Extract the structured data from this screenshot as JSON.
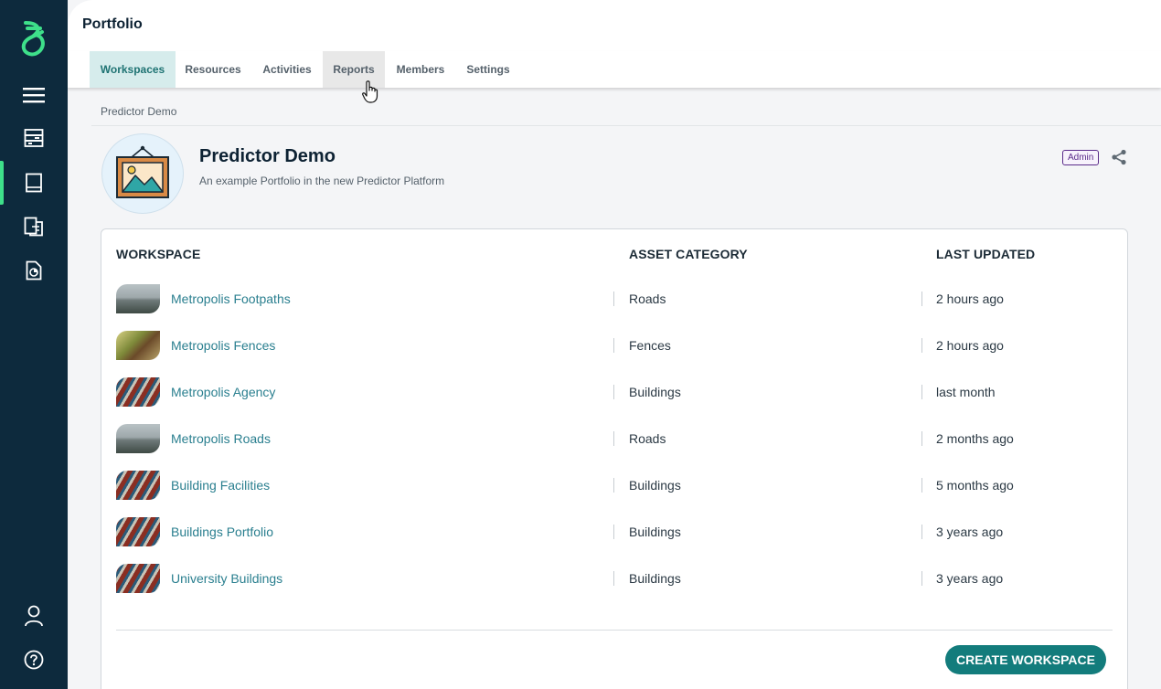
{
  "app": {
    "page_title": "Portfolio",
    "brand_color": "#0d2a3d",
    "accent_color": "#137c7c",
    "logo_color": "#3ee08a"
  },
  "sidebar": {
    "items": [
      {
        "icon": "menu-icon"
      },
      {
        "icon": "server-icon"
      },
      {
        "icon": "book-icon",
        "active": true
      },
      {
        "icon": "documents-icon"
      },
      {
        "icon": "report-icon"
      },
      {
        "icon": "user-icon"
      },
      {
        "icon": "help-icon"
      }
    ]
  },
  "tabs": [
    {
      "label": "Workspaces",
      "active": true
    },
    {
      "label": "Resources"
    },
    {
      "label": "Activities"
    },
    {
      "label": "Reports",
      "hover": true
    },
    {
      "label": "Members"
    },
    {
      "label": "Settings"
    }
  ],
  "breadcrumb": "Predictor Demo",
  "portfolio": {
    "name": "Predictor Demo",
    "description": "An example Portfolio in the new Predictor Platform",
    "badge": "Admin",
    "share_icon": "share-icon"
  },
  "table": {
    "headers": {
      "workspace": "WORKSPACE",
      "asset_category": "ASSET CATEGORY",
      "last_updated": "LAST UPDATED"
    },
    "rows": [
      {
        "name": "Metropolis Footpaths",
        "category": "Roads",
        "updated": "2 hours ago",
        "thumb": "road"
      },
      {
        "name": "Metropolis Fences",
        "category": "Fences",
        "updated": "2 hours ago",
        "thumb": "fence"
      },
      {
        "name": "Metropolis Agency",
        "category": "Buildings",
        "updated": "last month",
        "thumb": "building"
      },
      {
        "name": "Metropolis Roads",
        "category": "Roads",
        "updated": "2 months ago",
        "thumb": "road"
      },
      {
        "name": "Building Facilities",
        "category": "Buildings",
        "updated": "5 months ago",
        "thumb": "building"
      },
      {
        "name": "Buildings Portfolio",
        "category": "Buildings",
        "updated": "3 years ago",
        "thumb": "building"
      },
      {
        "name": "University Buildings",
        "category": "Buildings",
        "updated": "3 years ago",
        "thumb": "building"
      }
    ]
  },
  "actions": {
    "create_workspace": "CREATE WORKSPACE"
  }
}
